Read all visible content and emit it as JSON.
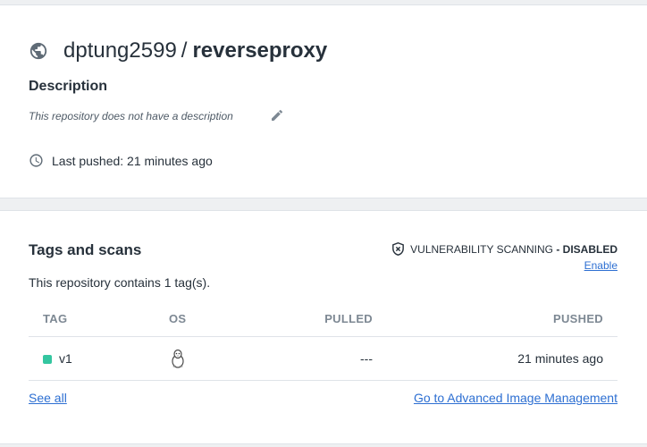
{
  "repo": {
    "namespace": "dptung2599",
    "separator": "/",
    "name": "reverseproxy",
    "visibility_icon": "globe-icon"
  },
  "description": {
    "heading": "Description",
    "text": "This repository does not have a description",
    "edit_icon": "pencil-icon"
  },
  "last_pushed": {
    "text": "Last pushed: 21 minutes ago",
    "icon": "clock-icon"
  },
  "tags_section": {
    "heading": "Tags and scans",
    "vulnerability_label": "VULNERABILITY SCANNING",
    "vulnerability_sep": " - ",
    "vulnerability_status": "DISABLED",
    "enable_link": "Enable",
    "count_text": "This repository contains 1 tag(s).",
    "columns": {
      "tag": "TAG",
      "os": "OS",
      "pulled": "PULLED",
      "pushed": "PUSHED"
    },
    "rows": [
      {
        "tag": "v1",
        "os_icon": "linux-tux-icon",
        "pulled": "---",
        "pushed": "21 minutes ago",
        "status_color": "#34c6a0"
      }
    ],
    "see_all": "See all",
    "advanced_link": "Go to Advanced Image Management"
  },
  "colors": {
    "link": "#2d6fd2",
    "background": "#eef0f2",
    "card": "#ffffff",
    "tag_status": "#34c6a0"
  }
}
